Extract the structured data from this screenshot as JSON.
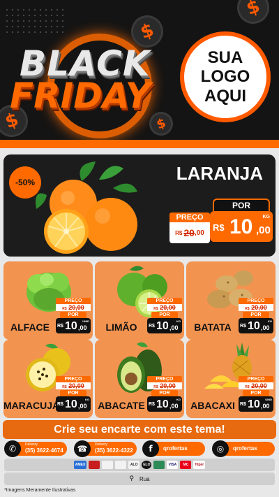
{
  "header": {
    "title_line1": "BLACK",
    "title_line2": "FRIDAY",
    "logo_line1": "SUA",
    "logo_line2": "LOGO",
    "logo_line3": "AQUI",
    "coin_symbol": "$"
  },
  "featured": {
    "discount": "-50%",
    "name": "LARANJA",
    "preco_label": "PREÇO",
    "old_currency": "R$",
    "old_price_int": "20",
    "old_price_cents": ",00",
    "por_label": "POR",
    "new_currency": "R$",
    "new_price_int": "10",
    "new_price_cents": ",00",
    "unit": "KG"
  },
  "products": [
    {
      "name": "ALFACE",
      "preco_label": "PREÇO",
      "old_currency": "R$",
      "old_price": "20,00",
      "por_label": "POR",
      "new_currency": "R$",
      "new_price_int": "10",
      "new_price_cents": ",00",
      "unit": "UNID"
    },
    {
      "name": "LIMÃO",
      "preco_label": "PREÇO",
      "old_currency": "R$",
      "old_price": "20,00",
      "por_label": "POR",
      "new_currency": "R$",
      "new_price_int": "10",
      "new_price_cents": ",00",
      "unit": "KG"
    },
    {
      "name": "BATATA",
      "preco_label": "PREÇO",
      "old_currency": "R$",
      "old_price": "20,00",
      "por_label": "POR",
      "new_currency": "R$",
      "new_price_int": "10",
      "new_price_cents": ",00",
      "unit": "KG"
    },
    {
      "name": "MARACUJÁ",
      "preco_label": "PREÇO",
      "old_currency": "R$",
      "old_price": "20,00",
      "por_label": "POR",
      "new_currency": "R$",
      "new_price_int": "10",
      "new_price_cents": ",00",
      "unit": "KG"
    },
    {
      "name": "ABACATE",
      "preco_label": "PREÇO",
      "old_currency": "R$",
      "old_price": "20,00",
      "por_label": "POR",
      "new_currency": "R$",
      "new_price_int": "10",
      "new_price_cents": ",00",
      "unit": "KG"
    },
    {
      "name": "ABACAXI",
      "preco_label": "PREÇO",
      "old_currency": "R$",
      "old_price": "20,00",
      "por_label": "POR",
      "new_currency": "R$",
      "new_price_int": "10",
      "new_price_cents": ",00",
      "unit": "UNID"
    }
  ],
  "cta": "Crie seu encarte com este tema!",
  "contacts": [
    {
      "icon": "whatsapp-icon",
      "label": "Delivery",
      "value": "(35) 3622-4674"
    },
    {
      "icon": "phone-icon",
      "label": "Delivery",
      "value": "(35) 3622-4322"
    },
    {
      "icon": "facebook-icon",
      "label": "",
      "value": "qrofertas"
    },
    {
      "icon": "instagram-icon",
      "label": "",
      "value": "qrofertas"
    }
  ],
  "payment_methods": [
    "AMEX",
    "",
    "",
    "",
    "ALO",
    "ELO",
    "",
    "VISA",
    "MC",
    "Hiper"
  ],
  "address": "Rua",
  "disclaimer": "*Imagens Meramente Ilustrativas",
  "colors": {
    "accent": "#ff6a00",
    "dark": "#141414",
    "card": "#f29350"
  }
}
